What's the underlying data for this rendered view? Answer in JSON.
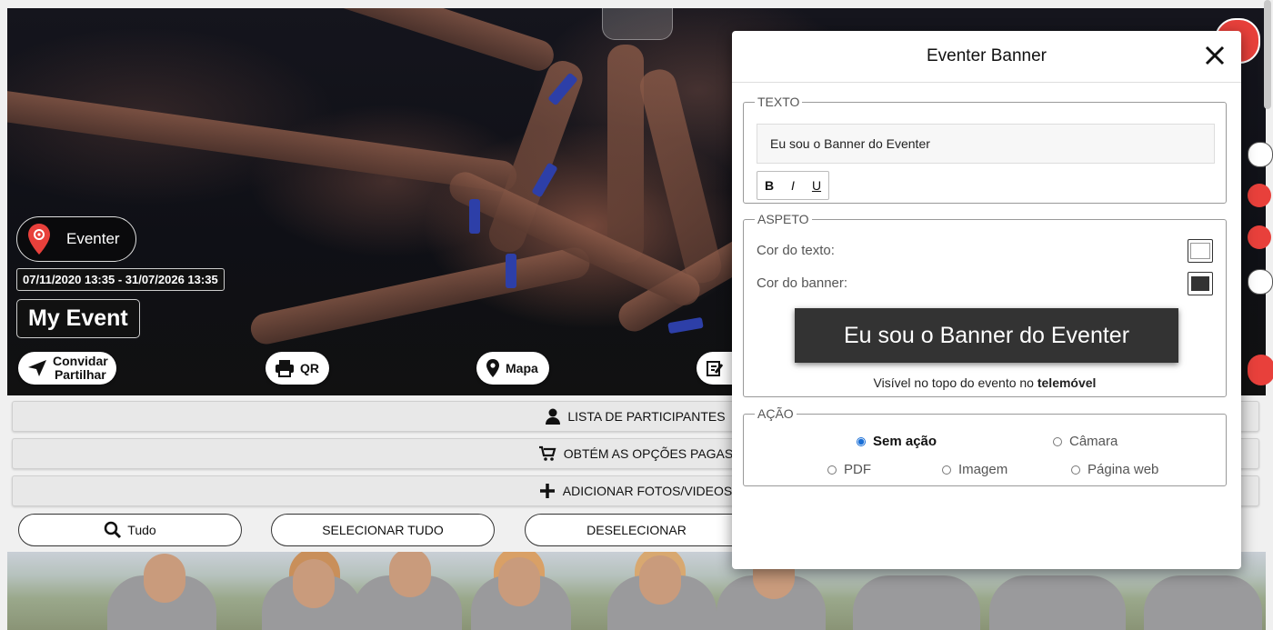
{
  "hero": {
    "brand_label": "Eventer",
    "dates": "07/11/2020 13:35 - 31/07/2026 13:35",
    "event_name": "My Event",
    "invite_line1": "Convidar",
    "invite_line2": "Partilhar",
    "qr_label": "QR",
    "map_label": "Mapa"
  },
  "bars": {
    "participants": "LISTA DE PARTICIPANTES",
    "paid_options": "OBTÉM AS OPÇÕES PAGAS",
    "add_media": "ADICIONAR FOTOS/VIDEOS"
  },
  "selection": {
    "all": "Tudo",
    "select_all": "SELECIONAR TUDO",
    "deselect": "DESELECIONAR"
  },
  "dialog": {
    "title": "Eventer Banner",
    "texto_legend": "TEXTO",
    "text_value": "Eu sou o Banner do Eventer",
    "format": {
      "bold": "B",
      "italic": "I",
      "underline": "U"
    },
    "aspeto_legend": "ASPETO",
    "text_color_label": "Cor do texto:",
    "banner_color_label": "Cor do banner:",
    "text_color": "#ffffff",
    "banner_color": "#333333",
    "preview_text": "Eu sou o Banner do Eventer",
    "visible_note": "Visível no topo do evento no",
    "visible_note_bold": "telemóvel",
    "acao_legend": "AÇÃO",
    "actions": [
      {
        "label": "Sem ação",
        "selected": true
      },
      {
        "label": "Câmara",
        "selected": false
      },
      {
        "label": "PDF",
        "selected": false
      },
      {
        "label": "Imagem",
        "selected": false
      },
      {
        "label": "Página web",
        "selected": false
      }
    ]
  },
  "colors": {
    "accent": "#e8403b",
    "radio": "#1a6fd6",
    "band": "#2d3fa8"
  }
}
